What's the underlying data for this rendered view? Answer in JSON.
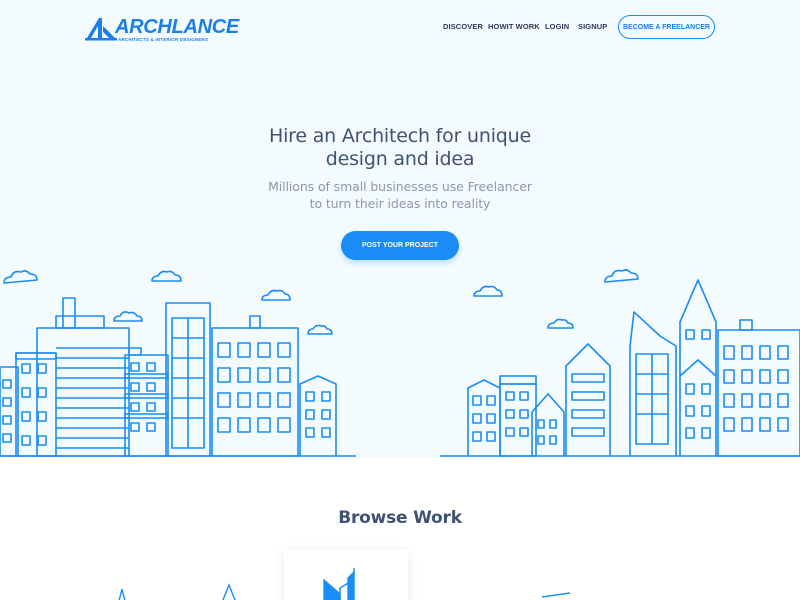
{
  "brand": {
    "name": "ARCHLANCE",
    "tagline": "ARCHITECTS & INTERIOR DESIGNERS",
    "color": "#1a7fe8"
  },
  "nav": {
    "items": [
      {
        "label": "DISCOVER"
      },
      {
        "label": "HOWIT WORK"
      },
      {
        "label": "LOGIN"
      },
      {
        "label": "SIGNUP"
      }
    ],
    "cta_label": "BECOME A FREELANCER"
  },
  "hero": {
    "title_line1": "Hire an Architech for unique",
    "title_line2": "design and idea",
    "subtitle_line1": "Millions of small businesses use Freelancer",
    "subtitle_line2": "to turn their ideas into reality",
    "cta_label": "POST YOUR PROJECT",
    "background": "#f3fbfe",
    "line_color": "#1a8cf5"
  },
  "browse": {
    "title": "Browse Work"
  }
}
